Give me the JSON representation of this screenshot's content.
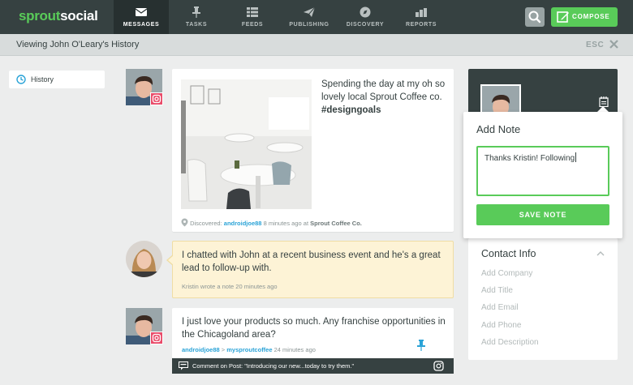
{
  "brand": {
    "logo_part1": "sprout",
    "logo_part2": "social",
    "accent": "#59cb59",
    "nav_bg": "#364141"
  },
  "nav": {
    "items": [
      {
        "label": "MESSAGES",
        "icon": "envelope-icon",
        "active": true
      },
      {
        "label": "TASKS",
        "icon": "pin-icon",
        "active": false
      },
      {
        "label": "FEEDS",
        "icon": "feeds-list-icon",
        "active": false
      },
      {
        "label": "PUBLISHING",
        "icon": "paper-plane-icon",
        "active": false
      },
      {
        "label": "DISCOVERY",
        "icon": "compass-icon",
        "active": false
      },
      {
        "label": "REPORTS",
        "icon": "bar-chart-icon",
        "active": false
      }
    ],
    "search_icon": "search-icon",
    "compose_label": "COMPOSE"
  },
  "subheader": {
    "title": "Viewing John O'Leary's History",
    "esc_label": "ESC"
  },
  "sidebar": {
    "history_label": "History"
  },
  "post1": {
    "text_plain": "Spending the day at my oh so lovely local Sprout Coffee co. ",
    "hashtag": "#designgoals",
    "meta_prefix": "Discovered:",
    "meta_user": "androidjoe88",
    "meta_time": "8 minutes ago at",
    "meta_place": "Sprout Coffee Co."
  },
  "note": {
    "text": "I chatted with John at a recent business event and he's a great lead to follow-up with.",
    "meta": "Kristin wrote a note 20 minutes ago"
  },
  "post2": {
    "text": "I just love your products so much. Any franchise opportunities in the Chicagoland area?",
    "meta_user": "androidjoe88",
    "meta_sep": ">",
    "meta_target": "mysproutcoffee",
    "meta_time": "24 minutes ago",
    "comment_bar": "Comment on Post: \"Introducing our new...today to try them.\""
  },
  "add_note": {
    "title": "Add Note",
    "value": "Thanks Kristin! Following",
    "save_label": "SAVE NOTE"
  },
  "contact_info": {
    "title": "Contact Info",
    "fields": [
      "Add Company",
      "Add Title",
      "Add Email",
      "Add Phone",
      "Add Description"
    ]
  }
}
